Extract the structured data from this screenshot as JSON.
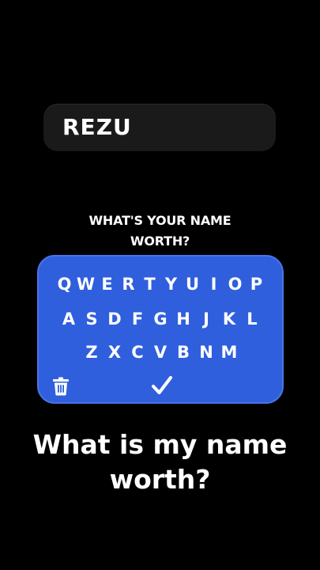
{
  "name_field": {
    "value": "REZU"
  },
  "question": {
    "line1": "WHAT'S YOUR NAME",
    "line2": "WORTH?"
  },
  "keyboard": {
    "row1": [
      "Q",
      "W",
      "E",
      "R",
      "T",
      "Y",
      "U",
      "I",
      "O",
      "P"
    ],
    "row2": [
      "A",
      "S",
      "D",
      "F",
      "G",
      "H",
      "J",
      "K",
      "L"
    ],
    "row3": [
      "Z",
      "X",
      "C",
      "V",
      "B",
      "N",
      "M"
    ],
    "delete_icon": "trash-icon",
    "submit_icon": "checkmark-icon"
  },
  "caption": {
    "line1": "What is my name",
    "line2": "worth?"
  },
  "colors": {
    "background": "#000000",
    "keyboard": "#2f5fdd",
    "field": "#1a1a1a"
  }
}
